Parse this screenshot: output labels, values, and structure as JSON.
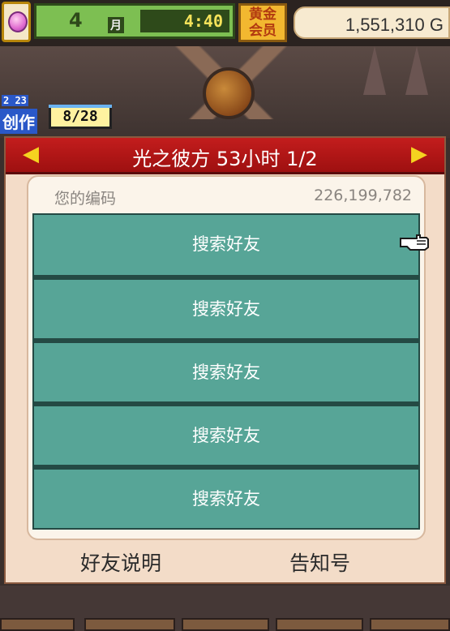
{
  "hud": {
    "month_number": "4",
    "month_unit": "月",
    "time": "4:40",
    "vip_label_line1": "黄金",
    "vip_label_line2": "会员",
    "gold_amount": "1,551,310",
    "gold_unit": "G"
  },
  "scene": {
    "create_small": "2 23",
    "create_label": "创作",
    "create_count": "8/28"
  },
  "dialog": {
    "title": "光之彼方  53小时 1/2",
    "your_code_label": "您的编码",
    "your_code_value": "226,199,782",
    "slots": [
      {
        "label": "搜索好友"
      },
      {
        "label": "搜索好友"
      },
      {
        "label": "搜索好友"
      },
      {
        "label": "搜索好友"
      },
      {
        "label": "搜索好友"
      }
    ],
    "footer_left": "好友说明",
    "footer_right": "告知号"
  },
  "colors": {
    "header_red": "#c31d1d",
    "slot_teal": "#57a597",
    "dialog_bg": "#f3dcc8",
    "arrow_yellow": "#f5d320"
  },
  "icons": {
    "prev": "triangle-left-icon",
    "next": "triangle-right-icon",
    "pointer": "pointing-hand-icon"
  }
}
